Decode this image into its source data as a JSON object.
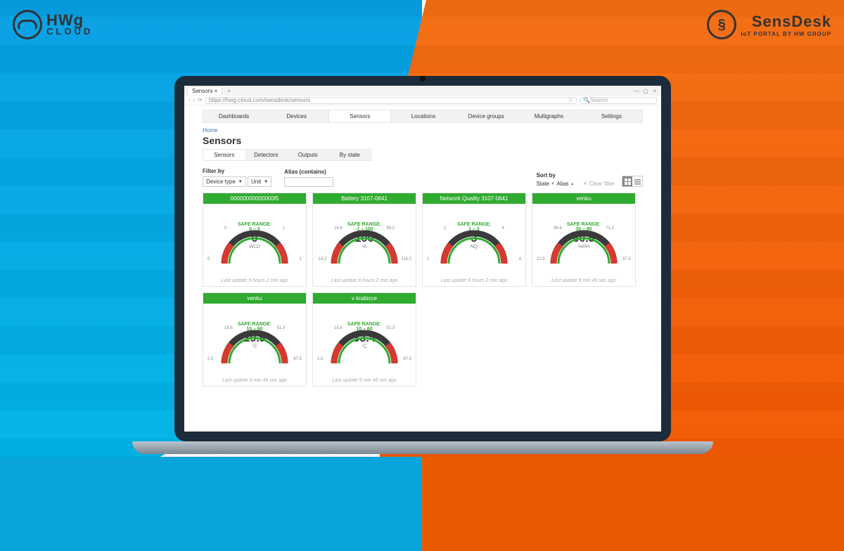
{
  "logos": {
    "left_l1": "HWg",
    "left_l2": "CLOUD",
    "right_l1": "SensDesk",
    "right_l2": "IoT PORTAL BY HW GROUP"
  },
  "browser": {
    "tab_title": "Sensors",
    "tab_close": "×",
    "new_tab": "+",
    "win_min": "—",
    "win_max": "▢",
    "win_close": "×",
    "nav_back": "‹",
    "nav_fwd": "›",
    "nav_reload": "⟳",
    "url": "https://hwg-cloud.com/sensdesk/sensors",
    "star": "☆",
    "search_placeholder": "Search"
  },
  "nav": {
    "items": [
      "Dashboards",
      "Devices",
      "Sensors",
      "Locations",
      "Device groups",
      "Multigraphs",
      "Settings"
    ],
    "active": 2
  },
  "crumb": "Home",
  "title": "Sensors",
  "subnav": {
    "items": [
      "Sensors",
      "Detectors",
      "Outputs",
      "By state"
    ],
    "active": 0
  },
  "filters": {
    "filterby_label": "Filter by",
    "device_type": "Device type",
    "unit": "Unit",
    "alias_label": "Alias (contains)",
    "sortby_label": "Sort by",
    "sort_state": "State",
    "sort_alias": "Alias",
    "clear": "Clear filter"
  },
  "safe_label": "SAFE RANGE:",
  "sensors": [
    {
      "name": "00000000000000f5",
      "range": "0 – 0",
      "value": "0",
      "unit": "WLD",
      "ticks": {
        "tl": "0",
        "tr": "1",
        "bl": "0",
        "br": "1"
      },
      "updated": "Last update 9 hours 2 min ago"
    },
    {
      "name": "Battery 3107-0641",
      "range": "-1 – 100",
      "value": "100",
      "unit": "%",
      "ticks": {
        "tl": "18.6",
        "tr": "88.2",
        "bl": "-15.2",
        "br": "115.2"
      },
      "updated": "Last update 9 hours 2 min ago"
    },
    {
      "name": "Network Quality 3107-0641",
      "range": "1 – 3",
      "value": "3",
      "unit": "NQ",
      "ticks": {
        "tl": "2",
        "tr": "4",
        "bl": "1",
        "br": "4"
      },
      "updated": "Last update 9 hours 2 min ago"
    },
    {
      "name": "venku",
      "range": "30 – 80",
      "value": "60.5",
      "unit": "%RH",
      "ticks": {
        "tl": "36.8",
        "tr": "71.2",
        "bl": "22.5",
        "br": "87.5"
      },
      "updated": "Last update 9 min 46 sec ago"
    },
    {
      "name": "venku",
      "range": "10 – 60",
      "value": "29.9",
      "unit": "°C",
      "ticks": {
        "tl": "18.8",
        "tr": "51.3",
        "bl": "2.5",
        "br": "67.5"
      },
      "updated": "Last update 9 min 46 sec ago"
    },
    {
      "name": "v krabicce",
      "range": "10 – 60",
      "value": "33.4",
      "unit": "°C",
      "ticks": {
        "tl": "18.8",
        "tr": "51.3",
        "bl": "2.5",
        "br": "67.5"
      },
      "updated": "Last update 9 min 46 sec ago"
    }
  ]
}
